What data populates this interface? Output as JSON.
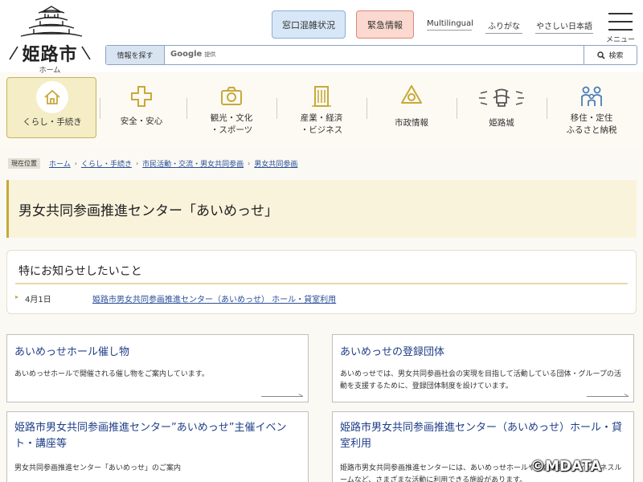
{
  "header": {
    "logo_name": "姫路市",
    "logo_home": "ホーム",
    "crowd_button": "窓口混雑状況",
    "emergency_button": "緊急情報",
    "lang_links": [
      "Multilingual",
      "ふりがな",
      "やさしい日本語"
    ],
    "menu_label": "メニュー",
    "search_tag": "情報を探す",
    "search_brand": "Google",
    "search_brand_note": "提供",
    "search_button": "検索",
    "search_value": ""
  },
  "nav": {
    "items": [
      {
        "label": "くらし・手続き",
        "icon": "house-icon"
      },
      {
        "label": "安全・安心",
        "icon": "cross-icon"
      },
      {
        "label": "観光・文化\n・スポーツ",
        "icon": "camera-icon"
      },
      {
        "label": "産業・経済\n・ビジネス",
        "icon": "building-icon"
      },
      {
        "label": "市政情報",
        "icon": "city-emblem-icon"
      },
      {
        "label": "姫路城",
        "icon": "castle-icon"
      },
      {
        "label": "移住・定住\nふるさと納税",
        "icon": "family-icon"
      }
    ],
    "accent": "#c8b35a"
  },
  "breadcrumb": {
    "here": "現在位置",
    "items": [
      "ホーム",
      "くらし・手続き",
      "市民活動・交流・男女共同参画",
      "男女共同参画"
    ]
  },
  "page_title": "男女共同参画推進センター「あいめっせ」",
  "notice": {
    "heading": "特にお知らせしたいこと",
    "date": "4月1日",
    "link": "姫路市男女共同参画推進センター（あいめっせ） ホール・貸室利用"
  },
  "cards": [
    {
      "title": "あいめっせホール催し物",
      "desc": "あいめっせホールで開催される催し物をご案内しています。"
    },
    {
      "title": "あいめっせの登録団体",
      "desc": "あいめっせでは、男女共同参画社会の実現を目指して活動している団体・グループの活動を支援するために、登録団体制度を設けています。"
    },
    {
      "title": "姫路市男女共同参画推進センター”あいめっせ”主催イベント・講座等",
      "desc": "男女共同参画推進センター「あいめっせ」のご案内"
    },
    {
      "title": "姫路市男女共同参画推進センター（あいめっせ）ホール・貸室利用",
      "desc": "姫路市男女共同参画推進センターには、あいめっせホールや、会議室やフィットネスルームなど、さまざまな活動に利用できる施設があります。"
    }
  ],
  "copyright": "©MDATA"
}
